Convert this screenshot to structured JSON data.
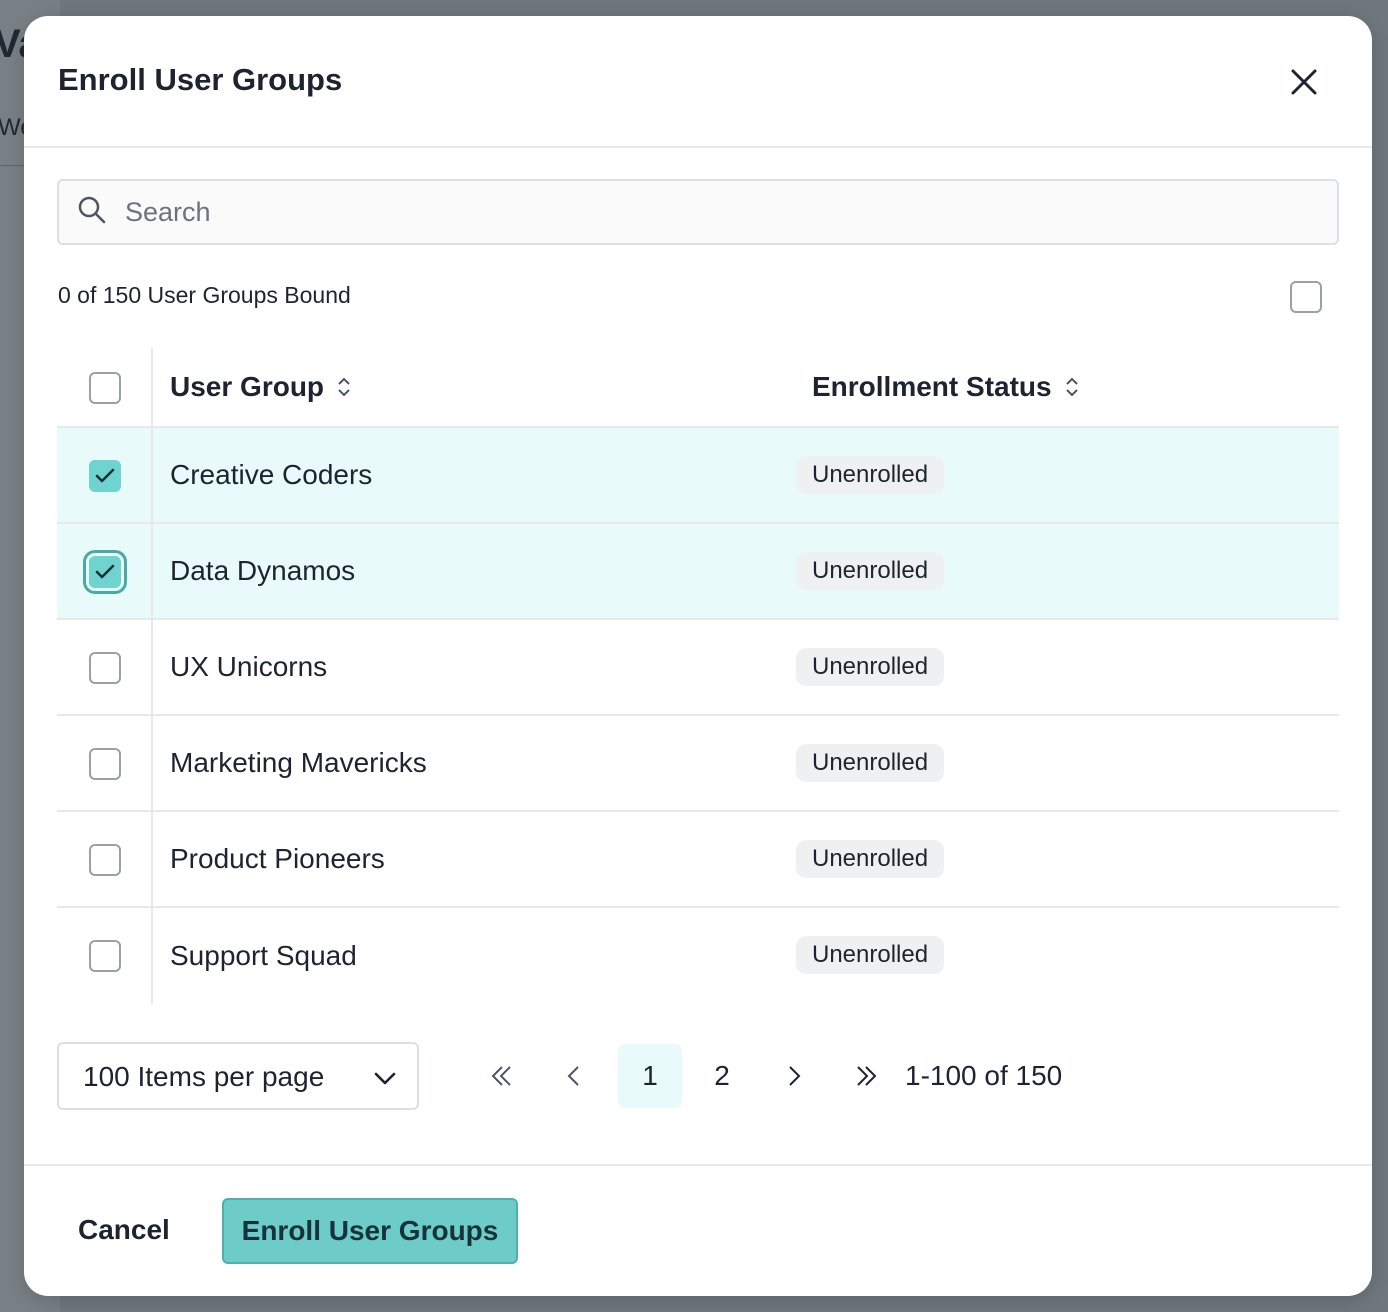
{
  "background": {
    "title_fragment": "Va",
    "subtitle_fragment": "We"
  },
  "modal": {
    "title": "Enroll User Groups",
    "search": {
      "placeholder": "Search",
      "value": ""
    },
    "bound_count": "0 of 150 User Groups Bound",
    "table": {
      "columns": [
        "User Group",
        "Enrollment Status"
      ],
      "rows": [
        {
          "name": "Creative Coders",
          "status": "Unenrolled",
          "checked": true,
          "focused": false
        },
        {
          "name": "Data Dynamos",
          "status": "Unenrolled",
          "checked": true,
          "focused": true
        },
        {
          "name": "UX Unicorns",
          "status": "Unenrolled",
          "checked": false,
          "focused": false
        },
        {
          "name": "Marketing Mavericks",
          "status": "Unenrolled",
          "checked": false,
          "focused": false
        },
        {
          "name": "Product Pioneers",
          "status": "Unenrolled",
          "checked": false,
          "focused": false
        },
        {
          "name": "Support Squad",
          "status": "Unenrolled",
          "checked": false,
          "focused": false
        }
      ]
    },
    "pagination": {
      "per_page_label": "100 Items per page",
      "pages": [
        "1",
        "2"
      ],
      "current_page": "1",
      "range_label": "1-100 of 150"
    },
    "footer": {
      "cancel_label": "Cancel",
      "submit_label": "Enroll User Groups"
    }
  },
  "colors": {
    "accent": "#6dcbc8",
    "selected_row": "#e8fafa",
    "badge_bg": "#eef0f2"
  }
}
